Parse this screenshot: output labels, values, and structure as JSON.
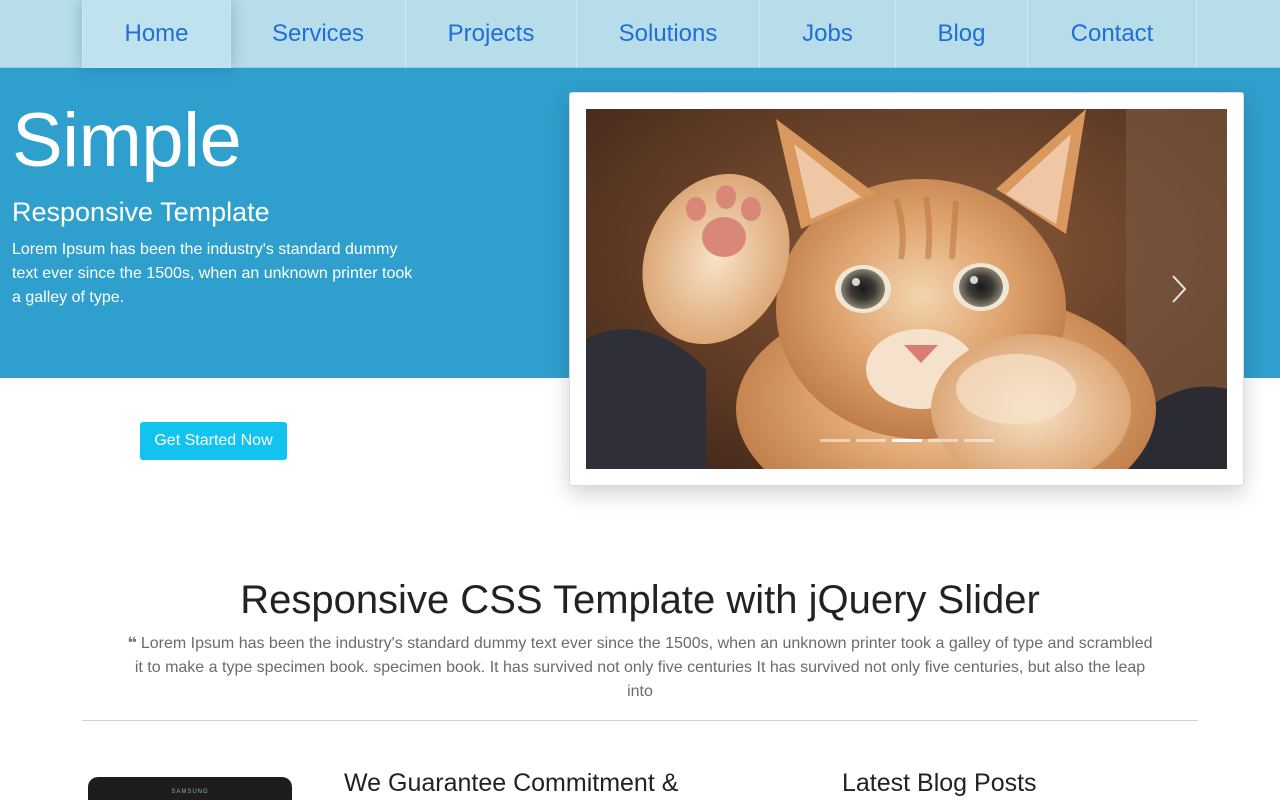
{
  "nav": {
    "items": [
      {
        "label": "Home",
        "active": true
      },
      {
        "label": "Services"
      },
      {
        "label": "Projects"
      },
      {
        "label": "Solutions"
      },
      {
        "label": "Jobs"
      },
      {
        "label": "Blog"
      },
      {
        "label": "Contact"
      }
    ]
  },
  "hero": {
    "title": "Simple",
    "subtitle": "Responsive Template",
    "text": "Lorem Ipsum has been the industry's standard dummy text ever since the 1500s, when an unknown printer took a galley of type.",
    "cta_label": "Get Started Now"
  },
  "slider": {
    "slide_description": "orange-kitten-photo",
    "next_icon": "chevron-right-icon",
    "dots": 5,
    "active_dot": 2
  },
  "section": {
    "title": "Responsive CSS Template with jQuery Slider",
    "quote_icon": "quote-icon",
    "quote": "Lorem Ipsum has been the industry's standard dummy text ever since the 1500s, when an unknown printer took a galley of type and scrambled it to make a type specimen book. specimen book. It has survived not only five centuries It has survived not only five centuries, but also the leap into"
  },
  "columns": {
    "tablet_brand": "SAMSUNG",
    "commitment_title": "We Guarantee Commitment &",
    "blog_title": "Latest Blog Posts"
  },
  "colors": {
    "nav_bg": "#b6dde9",
    "nav_text": "#1f6fd6",
    "hero_bg": "#2f9fcd",
    "cta_bg": "#12c3ef"
  }
}
